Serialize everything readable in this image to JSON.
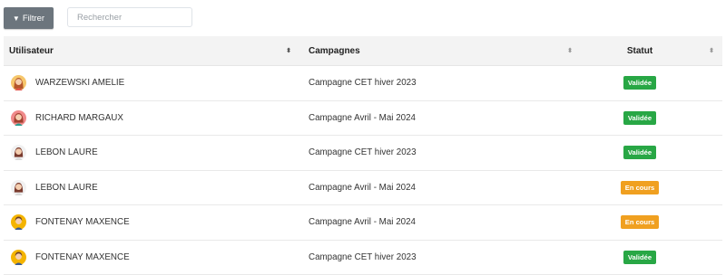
{
  "toolbar": {
    "filter_icon": "funnel-icon",
    "filter_label": "Filtrer",
    "search_placeholder": "Rechercher"
  },
  "table": {
    "columns": [
      {
        "label": "Utilisateur",
        "sort_icon": "sort-active-icon"
      },
      {
        "label": "Campagnes",
        "sort_icon": "sort-icon"
      },
      {
        "label": "Statut",
        "sort_icon": "sort-icon"
      }
    ],
    "rows": [
      {
        "user": "WARZEWSKI AMELIE",
        "avatar": "avatar-woman-red-hair",
        "campaign": "Campagne CET hiver 2023",
        "status": "Validée",
        "status_kind": "ok"
      },
      {
        "user": "RICHARD MARGAUX",
        "avatar": "avatar-woman-green-top",
        "campaign": "Campagne Avril - Mai 2024",
        "status": "Validée",
        "status_kind": "ok"
      },
      {
        "user": "LEBON LAURE",
        "avatar": "avatar-woman-brown-hair",
        "campaign": "Campagne CET hiver 2023",
        "status": "Validée",
        "status_kind": "ok"
      },
      {
        "user": "LEBON LAURE",
        "avatar": "avatar-woman-brown-hair",
        "campaign": "Campagne Avril - Mai 2024",
        "status": "En cours",
        "status_kind": "wip"
      },
      {
        "user": "FONTENAY MAXENCE",
        "avatar": "avatar-man-yellow",
        "campaign": "Campagne Avril - Mai 2024",
        "status": "En cours",
        "status_kind": "wip"
      },
      {
        "user": "FONTENAY MAXENCE",
        "avatar": "avatar-man-yellow",
        "campaign": "Campagne CET hiver 2023",
        "status": "Validée",
        "status_kind": "ok"
      }
    ]
  },
  "colors": {
    "filter_button": "#6c757d",
    "status_validated": "#28a745",
    "status_in_progress": "#f0a020",
    "header_bg": "#f3f3f3"
  }
}
